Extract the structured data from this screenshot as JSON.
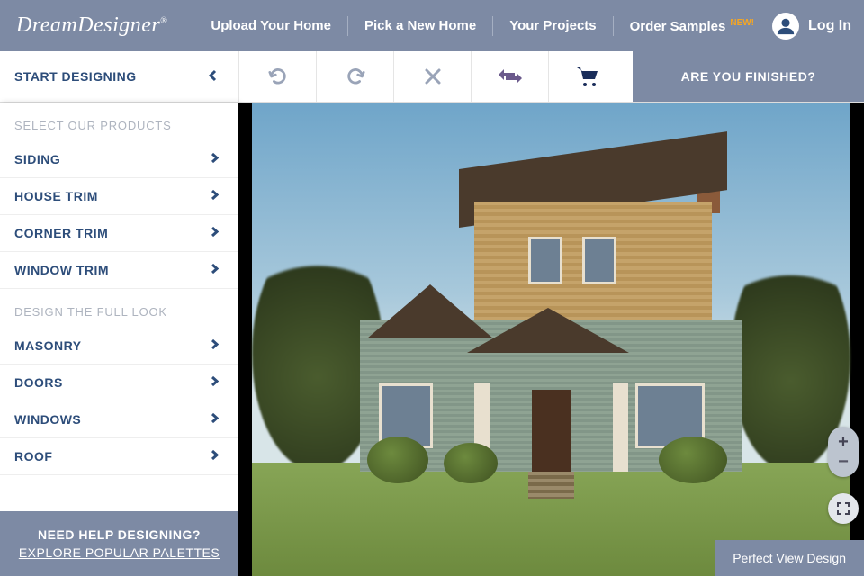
{
  "header": {
    "logo_part1": "Dream",
    "logo_part2": "Designer",
    "logo_reg": "®",
    "nav": [
      "Upload Your Home",
      "Pick a New Home",
      "Your Projects",
      "Order Samples"
    ],
    "new_badge": "NEW!",
    "login": "Log In"
  },
  "toolbar": {
    "start_designing": "START DESIGNING",
    "finished": "ARE YOU FINISHED?"
  },
  "sidebar": {
    "section1_title": "SELECT OUR PRODUCTS",
    "section1_items": [
      "SIDING",
      "HOUSE TRIM",
      "CORNER TRIM",
      "WINDOW TRIM"
    ],
    "section2_title": "DESIGN THE FULL LOOK",
    "section2_items": [
      "MASONRY",
      "DOORS",
      "WINDOWS",
      "ROOF"
    ],
    "help_title": "NEED HELP DESIGNING?",
    "help_link": "EXPLORE POPULAR PALETTES"
  },
  "canvas": {
    "perfect_view": "Perfect View Design",
    "zoom_in": "+",
    "zoom_out": "−"
  }
}
